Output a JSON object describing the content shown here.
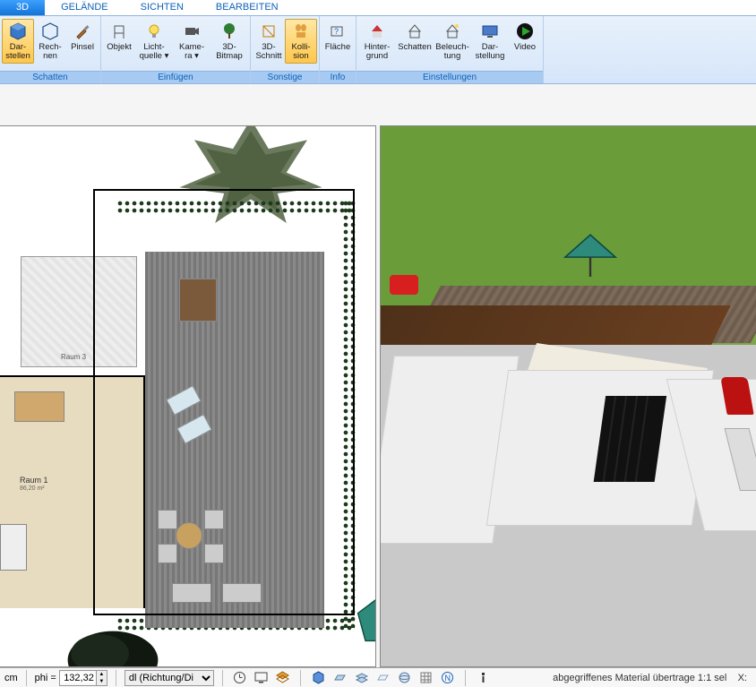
{
  "tabs": {
    "active": "3D",
    "items": [
      "3D",
      "GELÄNDE",
      "SICHTEN",
      "BEARBEITEN"
    ]
  },
  "ribbon": {
    "groups": [
      {
        "label": "Schatten",
        "items": [
          {
            "name": "darstellen-button",
            "label": "Dar-\nstellen",
            "selected": true
          },
          {
            "name": "rechnen-button",
            "label": "Rech-\nnen"
          },
          {
            "name": "pinsel-button",
            "label": "Pinsel"
          }
        ]
      },
      {
        "label": "Einfügen",
        "items": [
          {
            "name": "objekt-button",
            "label": "Objekt"
          },
          {
            "name": "lichtquelle-button",
            "label": "Licht-\nquelle ▾"
          },
          {
            "name": "kamera-button",
            "label": "Kame-\nra ▾"
          },
          {
            "name": "bitmap3d-button",
            "label": "3D-\nBitmap"
          }
        ]
      },
      {
        "label": "Sonstige",
        "items": [
          {
            "name": "schnitt3d-button",
            "label": "3D-\nSchnitt"
          },
          {
            "name": "kollision-button",
            "label": "Kolli-\nsion",
            "selected": true
          }
        ]
      },
      {
        "label": "Info",
        "items": [
          {
            "name": "flaeche-button",
            "label": "Fläche"
          }
        ]
      },
      {
        "label": "Einstellungen",
        "items": [
          {
            "name": "hintergrund-button",
            "label": "Hinter-\ngrund"
          },
          {
            "name": "schatten-button",
            "label": "Schatten"
          },
          {
            "name": "beleuchtung-button",
            "label": "Beleuch-\ntung"
          },
          {
            "name": "darstellung-button",
            "label": "Dar-\nstellung"
          },
          {
            "name": "video-button",
            "label": "Video"
          }
        ]
      }
    ]
  },
  "plan2d": {
    "room1": {
      "label": "Raum 1",
      "area": "86,20 m²"
    },
    "room3": {
      "label": "Raum 3"
    }
  },
  "statusbar": {
    "unit": "cm",
    "phi_label": "phi =",
    "phi_value": "132,32",
    "dl_label": "dl (Richtung/Di",
    "right_text": "abgegriffenes Material übertrage 1:1 sel",
    "coord_label": "X:"
  }
}
